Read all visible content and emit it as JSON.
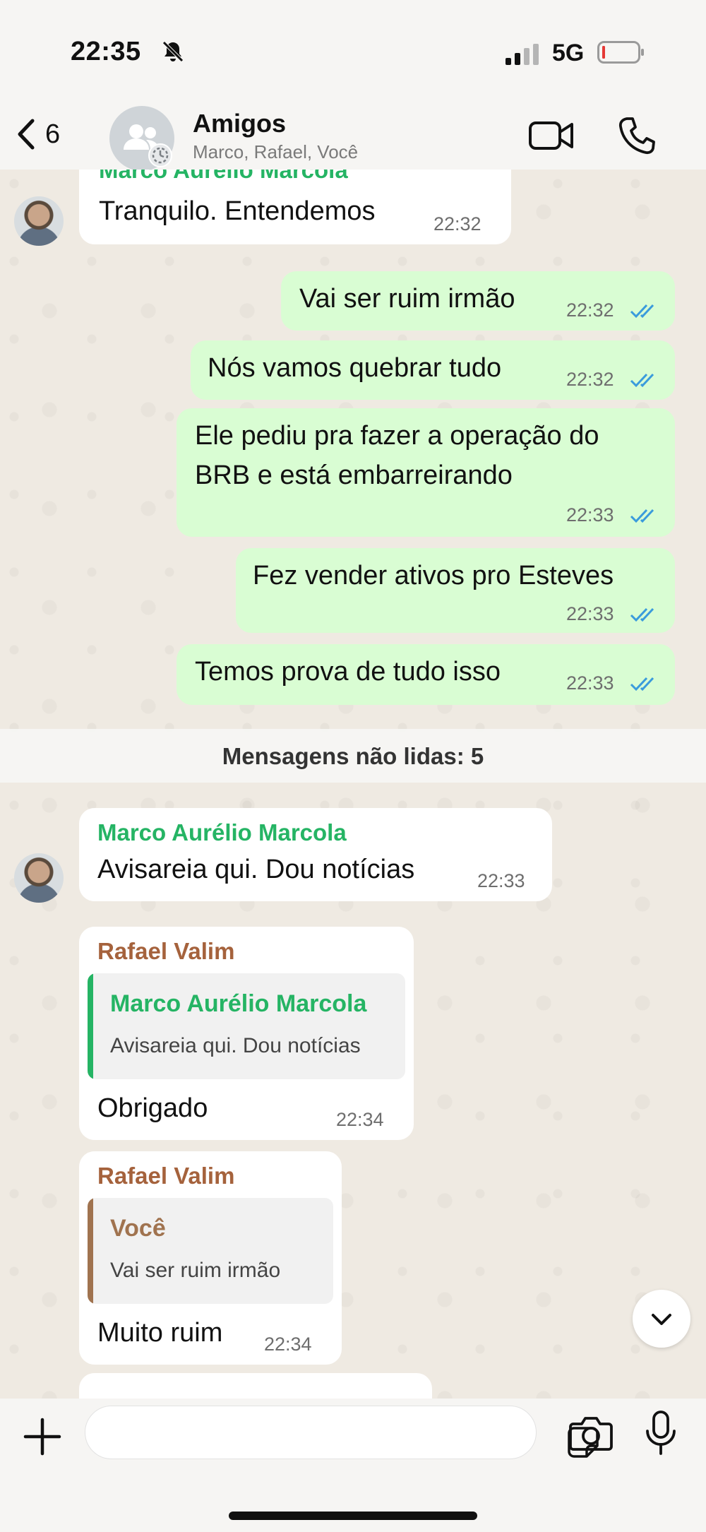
{
  "status_bar": {
    "time": "22:35",
    "network": "5G"
  },
  "header": {
    "back_count": "6",
    "title": "Amigos",
    "subtitle": "Marco, Rafael, Você"
  },
  "messages": {
    "m0": {
      "sender": "Marco Aurélio Marcola",
      "text": "Tranquilo. Entendemos",
      "time": "22:32"
    },
    "m1": {
      "text": "Vai ser ruim irmão",
      "time": "22:32"
    },
    "m2": {
      "text": "Nós vamos quebrar tudo",
      "time": "22:32"
    },
    "m3": {
      "line1": "Ele pediu pra fazer a operação do",
      "line2": "BRB e está embarreirando",
      "time": "22:33"
    },
    "m4": {
      "text": "Fez vender ativos pro Esteves",
      "time": "22:33"
    },
    "m5": {
      "text": "Temos prova de tudo isso",
      "time": "22:33"
    },
    "unread_label": "Mensagens não lidas: 5",
    "m6": {
      "sender": "Marco Aurélio Marcola",
      "text": "Avisareia qui. Dou notícias",
      "time": "22:33"
    },
    "m7": {
      "sender": "Rafael Valim",
      "quote_name": "Marco Aurélio Marcola",
      "quote_text": "Avisareia qui. Dou notícias",
      "text": "Obrigado",
      "time": "22:34"
    },
    "m8": {
      "sender": "Rafael Valim",
      "quote_name": "Você",
      "quote_text": "Vai ser ruim irmão",
      "text": "Muito ruim",
      "time": "22:34"
    }
  },
  "colors": {
    "marco": "#25b464",
    "rafael": "#a5623c",
    "quote_voce": "#a0734f",
    "ticks": "#3a9bdc",
    "outgoing": "#d9fdd3",
    "incoming": "#ffffff"
  },
  "icons": {
    "back": "chevron-left-icon",
    "video": "video-camera-icon",
    "call": "phone-icon",
    "plus": "plus-icon",
    "sticker": "sticker-icon",
    "camera": "camera-icon",
    "mic": "microphone-icon",
    "scroll": "chevron-down-icon"
  }
}
